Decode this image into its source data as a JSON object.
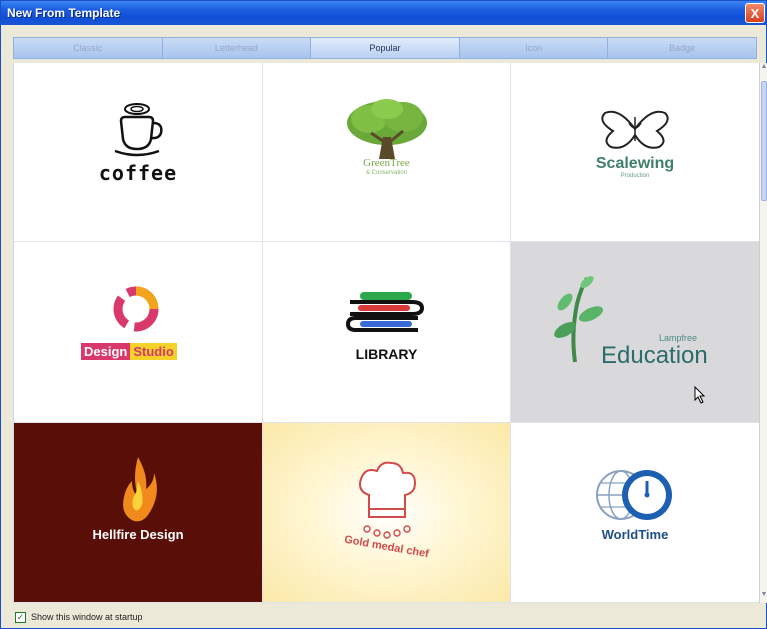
{
  "window": {
    "title": "New From Template",
    "close_glyph": "X"
  },
  "tabs": [
    {
      "label": "Classic",
      "active": false
    },
    {
      "label": "Letterhead",
      "active": false
    },
    {
      "label": "Popular",
      "active": true
    },
    {
      "label": "Icon",
      "active": false
    },
    {
      "label": "Badge",
      "active": false
    }
  ],
  "templates": [
    {
      "name": "coffee",
      "text": "coffee"
    },
    {
      "name": "greentree",
      "text": "GreenTree",
      "subtext": "& Conservation"
    },
    {
      "name": "scalewing",
      "text": "Scalewing",
      "subtext": "Production"
    },
    {
      "name": "design-studio",
      "text_a": "Design",
      "text_b": "Studio"
    },
    {
      "name": "library",
      "text": "LIBRARY"
    },
    {
      "name": "education",
      "text": "Education",
      "subtext": "Lampfree"
    },
    {
      "name": "hellfire",
      "text": "Hellfire Design"
    },
    {
      "name": "gold-medal-chef",
      "text": "Gold medal chef"
    },
    {
      "name": "worldtime",
      "text": "WorldTime"
    }
  ],
  "footer": {
    "startup_label": "Show this window at startup",
    "startup_checked": true
  },
  "colors": {
    "accent": "#1a57d6",
    "hover_cell": "#d9d9db",
    "hellfire_bg": "#5a0e08"
  },
  "scrollbar": {
    "up_glyph": "▲",
    "down_glyph": "▼"
  }
}
